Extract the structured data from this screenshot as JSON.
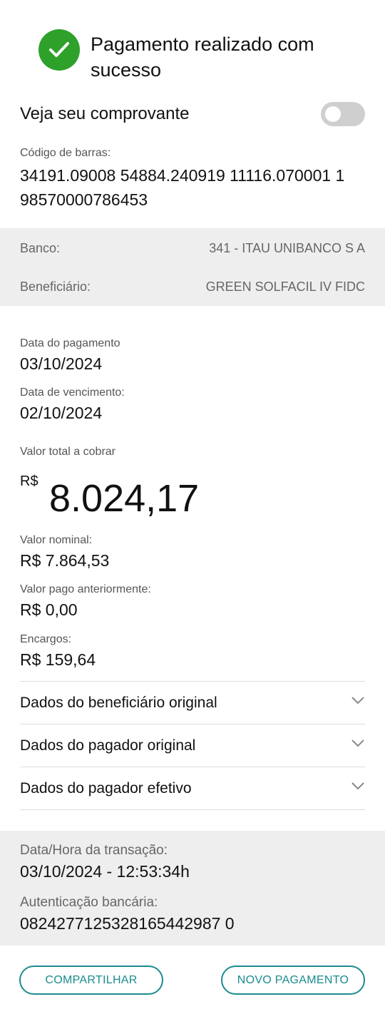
{
  "header": {
    "title": "Pagamento realizado com sucesso",
    "check_icon": "check-icon",
    "success_color": "#2ea12a"
  },
  "receipt": {
    "label": "Veja seu comprovante",
    "toggle_on": false
  },
  "barcode": {
    "label": "Código de barras:",
    "value": "34191.09008 54884.240919 11116.070001 1 98570000786453"
  },
  "bank": {
    "bank_label": "Banco:",
    "bank_value": "341 - ITAU UNIBANCO S A",
    "beneficiary_label": "Beneficiário:",
    "beneficiary_value": "GREEN SOLFACIL IV FIDC"
  },
  "dates": {
    "payment_label": "Data do pagamento",
    "payment_value": "03/10/2024",
    "due_label": "Data de vencimento:",
    "due_value": "02/10/2024"
  },
  "total": {
    "label": "Valor total a cobrar",
    "currency": "R$",
    "amount": "8.024,17"
  },
  "details": {
    "nominal_label": "Valor nominal:",
    "nominal_value": "R$ 7.864,53",
    "prior_label": "Valor pago anteriormente:",
    "prior_value": "R$ 0,00",
    "charges_label": "Encargos:",
    "charges_value": "R$ 159,64"
  },
  "accordions": [
    {
      "label": "Dados do beneficiário original",
      "icon": "chevron-down-icon"
    },
    {
      "label": "Dados do pagador original",
      "icon": "chevron-down-icon"
    },
    {
      "label": "Dados do pagador efetivo",
      "icon": "chevron-down-icon"
    }
  ],
  "transaction": {
    "datetime_label": "Data/Hora da transação:",
    "datetime_value": "03/10/2024 - 12:53:34h",
    "auth_label": "Autenticação bancária:",
    "auth_value": "0824277125328165442987 0"
  },
  "actions": {
    "share_label": "COMPARTILHAR",
    "new_payment_label": "NOVO PAGAMENTO",
    "accent_color": "#1c8b8f"
  }
}
